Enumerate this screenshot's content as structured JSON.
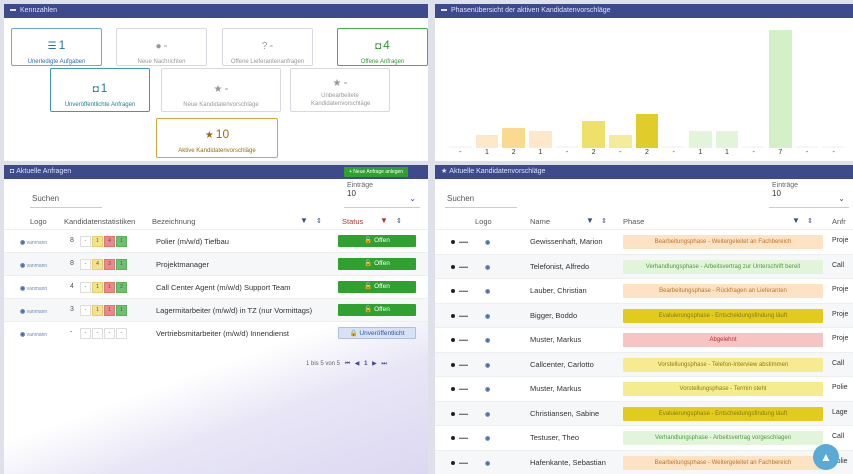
{
  "kpis": {
    "header": "Kennzahlen",
    "items": [
      {
        "value": "1",
        "label": "Unerledigte Aufgaben",
        "icon": "list-icon"
      },
      {
        "value": "-",
        "label": "Neue Nachrichten",
        "icon": "chat-icon"
      },
      {
        "value": "-",
        "label": "Offene Lieferantenanfragen",
        "icon": "question-icon"
      },
      {
        "value": "4",
        "label": "Offene Anfragen",
        "icon": "car-icon"
      },
      {
        "value": "1",
        "label": "Unveröffentlichte Anfragen",
        "icon": "car-icon"
      },
      {
        "value": "-",
        "label": "Neue Kandidatenvorschläge",
        "icon": "star-icon"
      },
      {
        "value": "-",
        "label": "Unbearbeitete Kandidatenvorschläge",
        "icon": "star-icon"
      },
      {
        "value": "10",
        "label": "Aktive Kandidatenvorschläge",
        "icon": "star-icon"
      }
    ]
  },
  "chart": {
    "header": "Phasenübersicht der aktiven Kandidatenvorschläge"
  },
  "chart_data": {
    "type": "bar",
    "categories": [
      "-",
      "1",
      "2",
      "1",
      "-",
      "2",
      "-",
      "2",
      "-",
      "1",
      "1",
      "-",
      "7",
      "-",
      "-"
    ],
    "values": [
      0,
      0.8,
      1.2,
      1,
      0,
      1.6,
      0.8,
      2,
      0,
      1,
      1,
      0,
      7,
      0,
      0
    ],
    "colors": [
      "#f5f6f8",
      "#fde8c9",
      "#fbd98f",
      "#fde8c9",
      "#f5f6f8",
      "#efe06a",
      "#f4ec9a",
      "#e0cc2a",
      "#f5f6f8",
      "#e2f4d9",
      "#e2f4d9",
      "#f5f6f8",
      "#d3f0c7",
      "#f5f6f8",
      "#f5f6f8"
    ],
    "ylim": [
      0,
      7.5
    ],
    "grid": false
  },
  "anfragen": {
    "header": "Aktuelle Anfragen",
    "new_button": "+ Neue Anfrage anlegen",
    "search_placeholder": "Suchen",
    "entries_label": "Einträge",
    "entries_value": "10",
    "columns": {
      "logo": "Logo",
      "stats": "Kandidatenstatistiken",
      "bez": "Bezeichnung",
      "status": "Status"
    },
    "rows": [
      {
        "logo": "vanmann",
        "count": "8",
        "stats": [
          "-",
          "1",
          "4",
          "1"
        ],
        "bez": "Polier (m/w/d) Tiefbau",
        "status": "Offen",
        "status_type": "green"
      },
      {
        "logo": "vanmann",
        "count": "8",
        "stats": [
          "-",
          "4",
          "3",
          "1"
        ],
        "bez": "Projektmanager",
        "status": "Offen",
        "status_type": "green"
      },
      {
        "logo": "vanmann",
        "count": "4",
        "stats": [
          "-",
          "1",
          "1",
          "2"
        ],
        "bez": "Call Center Agent (m/w/d) Support Team",
        "status": "Offen",
        "status_type": "green"
      },
      {
        "logo": "vanmann",
        "count": "3",
        "stats": [
          "-",
          "1",
          "1",
          "1"
        ],
        "bez": "Lagermitarbeiter (m/w/d) in TZ (nur Vormittags)",
        "status": "Offen",
        "status_type": "green"
      },
      {
        "logo": "vanmann",
        "count": "-",
        "stats": [
          "-",
          "-",
          "-",
          "-"
        ],
        "bez": "Vertriebsmitarbeiter (m/w/d) Innendienst",
        "status": "Unveröffentlicht",
        "status_type": "lblue"
      }
    ],
    "pager_text": "1 bis 5 von 5",
    "pager_page": "1"
  },
  "vorschlaege": {
    "header": "Aktuelle Kandidatenvorschläge",
    "search_placeholder": "Suchen",
    "entries_label": "Einträge",
    "entries_value": "10",
    "columns": {
      "logo": "Logo",
      "name": "Name",
      "phase": "Phase",
      "anfrage": "Anfr"
    },
    "rows": [
      {
        "name": "Gewissenhaft, Marion",
        "phase": "Bearbeitungsphase - Weitergeleitet an Fachbereich",
        "color": "#fde3c4",
        "tc": "#b9742a",
        "proj": "Proje"
      },
      {
        "name": "Telefonist, Alfredo",
        "phase": "Verhandlungsphase - Arbeitsvertrag zur Unterschrift bereit",
        "color": "#e2f4d9",
        "tc": "#4e9c3e",
        "proj": "Call"
      },
      {
        "name": "Lauber, Christian",
        "phase": "Bearbeitungsphase - Rückfragen an Lieferanten",
        "color": "#fde3c4",
        "tc": "#b9742a",
        "proj": "Proje"
      },
      {
        "name": "Bigger, Boddo",
        "phase": "Evaluierungsphase - Entscheidungsfindung läuft",
        "color": "#e3cb1e",
        "tc": "#8a7a10",
        "proj": "Proje"
      },
      {
        "name": "Muster, Markus",
        "phase": "Abgelehnt",
        "color": "#f7c4c4",
        "tc": "#b42f2f",
        "proj": "Proje"
      },
      {
        "name": "Callcenter, Carlotto",
        "phase": "Vorstellungsphase - Telefon-Interview abstimmen",
        "color": "#f6ec8f",
        "tc": "#8d7d12",
        "proj": "Call"
      },
      {
        "name": "Muster, Markus",
        "phase": "Vorstellungsphase - Termin steht",
        "color": "#f6ec8f",
        "tc": "#8d7d12",
        "proj": "Polie"
      },
      {
        "name": "Christiansen, Sabine",
        "phase": "Evaluierungsphase - Entscheidungsfindung läuft",
        "color": "#e3cb1e",
        "tc": "#8a7a10",
        "proj": "Lage"
      },
      {
        "name": "Testuser, Theo",
        "phase": "Verhandlungsphase - Arbeitsvertrag vorgeschlagen",
        "color": "#e2f4d9",
        "tc": "#4e9c3e",
        "proj": "Call"
      },
      {
        "name": "Hafenkante, Sebastian",
        "phase": "Bearbeitungsphase - Weitergeleitet an Fachbereich",
        "color": "#fde3c4",
        "tc": "#b9742a",
        "proj": "Polie"
      }
    ]
  }
}
